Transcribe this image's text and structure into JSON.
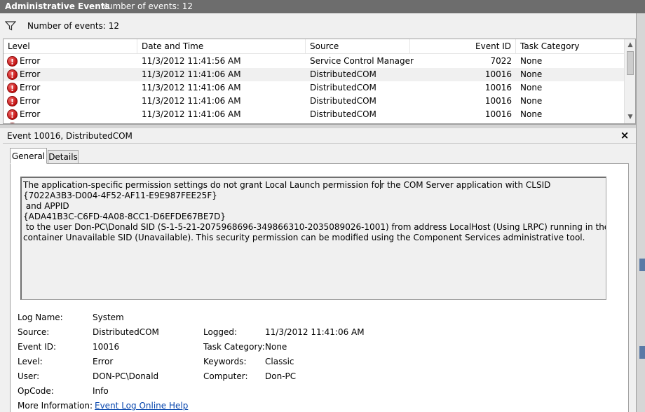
{
  "window": {
    "title": "Administrative Events",
    "count_label": "Number of events: 12"
  },
  "filter": {
    "icon": "funnel-icon",
    "count_label": "Number of events: 12"
  },
  "event_list": {
    "columns": [
      "Level",
      "Date and Time",
      "Source",
      "Event ID",
      "Task Category"
    ],
    "rows": [
      {
        "level": "Error",
        "date_time": "11/3/2012 11:41:56 AM",
        "source": "Service Control Manager",
        "event_id": "7022",
        "task_category": "None"
      },
      {
        "level": "Error",
        "date_time": "11/3/2012 11:41:06 AM",
        "source": "DistributedCOM",
        "event_id": "10016",
        "task_category": "None"
      },
      {
        "level": "Error",
        "date_time": "11/3/2012 11:41:06 AM",
        "source": "DistributedCOM",
        "event_id": "10016",
        "task_category": "None"
      },
      {
        "level": "Error",
        "date_time": "11/3/2012 11:41:06 AM",
        "source": "DistributedCOM",
        "event_id": "10016",
        "task_category": "None"
      },
      {
        "level": "Error",
        "date_time": "11/3/2012 11:41:06 AM",
        "source": "DistributedCOM",
        "event_id": "10016",
        "task_category": "None"
      }
    ],
    "selected_row": 1
  },
  "detail": {
    "title": "Event 10016, DistributedCOM",
    "close_glyph": "×",
    "tabs": [
      {
        "label": "General",
        "active": true
      },
      {
        "label": "Details",
        "active": false
      }
    ],
    "message_before_caret": "The application-specific permission settings do not grant Local Launch permission fo",
    "message_after_caret": "r the COM Server application with CLSID\n{7022A3B3-D004-4F52-AF11-E9E987FEE25F}\n and APPID\n{ADA41B3C-C6FD-4A08-8CC1-D6EFDE67BE7D}\n to the user Don-PC\\Donald SID (S-1-5-21-2075968696-349866310-2035089026-1001) from address LocalHost (Using LRPC) running in the application\ncontainer Unavailable SID (Unavailable). This security permission can be modified using the Component Services administrative tool.",
    "properties": {
      "log_name_label": "Log Name:",
      "log_name": "System",
      "source_label": "Source:",
      "source": "DistributedCOM",
      "logged_label": "Logged:",
      "logged": "11/3/2012 11:41:06 AM",
      "event_id_label": "Event ID:",
      "event_id": "10016",
      "task_category_label": "Task Category:",
      "task_category": "None",
      "level_label": "Level:",
      "level": "Error",
      "keywords_label": "Keywords:",
      "keywords": "Classic",
      "user_label": "User:",
      "user": "DON-PC\\Donald",
      "computer_label": "Computer:",
      "computer": "Don-PC",
      "opcode_label": "OpCode:",
      "opcode": "Info",
      "more_info_label": "More Information:",
      "more_info_link": "Event Log Online Help"
    }
  },
  "colors": {
    "titlebar": "#6d6d6d",
    "error_red": "#c01010",
    "link": "#0645ad"
  }
}
